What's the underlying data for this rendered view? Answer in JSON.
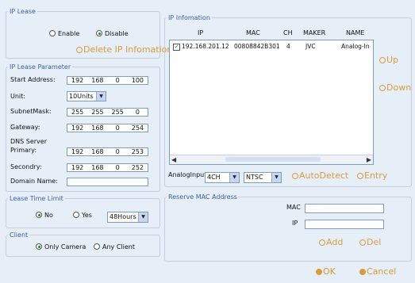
{
  "ip_lease": {
    "legend": "IP Lease",
    "enable_label": "Enable",
    "disable_label": "Disable",
    "delete_label": "Delete IP Infomation"
  },
  "lease_param": {
    "legend": "IP Lease Parameter",
    "start_label": "Start Address:",
    "start": [
      "192",
      "168",
      "0",
      "100"
    ],
    "unit_label": "Unit:",
    "unit_value": "10Units",
    "subnet_label": "SubnetMask:",
    "subnet": [
      "255",
      "255",
      "255",
      "0"
    ],
    "gateway_label": "Gateway:",
    "gateway": [
      "192",
      "168",
      "0",
      "254"
    ],
    "dns_label": "DNS Server",
    "primary_label": "Primary:",
    "primary": [
      "192",
      "168",
      "0",
      "253"
    ],
    "secondary_label": "Secondry:",
    "secondary": [
      "192",
      "168",
      "0",
      "252"
    ],
    "domain_label": "Domain Name:",
    "domain_value": ""
  },
  "lease_time": {
    "legend": "Lease Time Limit",
    "no_label": "No",
    "yes_label": "Yes",
    "hours_value": "48Hours"
  },
  "client": {
    "legend": "Client",
    "only_camera": "Only Camera",
    "any_client": "Any Client"
  },
  "ip_info": {
    "legend": "IP Infomation",
    "headers": {
      "ip": "IP",
      "mac": "MAC",
      "ch": "CH",
      "maker": "MAKER",
      "name": "NAME"
    },
    "rows": [
      {
        "ip": "192.168.201.12",
        "mac": "00808842B301",
        "ch": "4",
        "maker": "JVC",
        "name": "Analog-In"
      }
    ],
    "up_label": "Up",
    "down_label": "Down",
    "analog_input_label": "AnalogInput:",
    "analog_input_value": "4CH",
    "video_format_value": "NTSC",
    "autodetect_label": "AutoDetect",
    "entry_label": "Entry"
  },
  "reserve": {
    "legend": "Reserve MAC Address",
    "mac_label": "MAC",
    "ip_label": "IP",
    "add_label": "Add",
    "del_label": "Del"
  },
  "footer": {
    "ok_label": "OK",
    "cancel_label": "Cancel"
  }
}
